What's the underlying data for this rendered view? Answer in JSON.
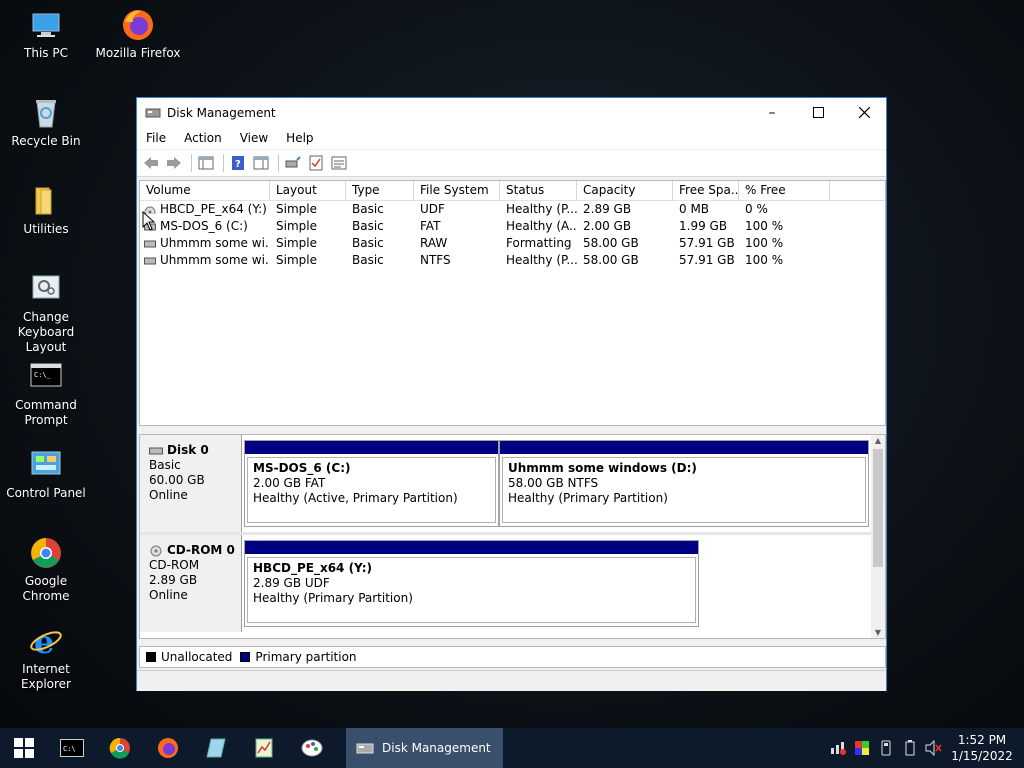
{
  "desktop": {
    "icons": [
      {
        "label": "This PC"
      },
      {
        "label": "Mozilla Firefox"
      },
      {
        "label": "Recycle Bin"
      },
      {
        "label": "Utilities"
      },
      {
        "label": "Change Keyboard Layout"
      },
      {
        "label": "Command Prompt"
      },
      {
        "label": "Control Panel"
      },
      {
        "label": "Google Chrome"
      },
      {
        "label": "Internet Explorer"
      }
    ]
  },
  "window": {
    "title": "Disk Management",
    "menu": [
      "File",
      "Action",
      "View",
      "Help"
    ],
    "columns": [
      "Volume",
      "Layout",
      "Type",
      "File System",
      "Status",
      "Capacity",
      "Free Spa...",
      "% Free"
    ],
    "volumes": [
      [
        "HBCD_PE_x64 (Y:)",
        "Simple",
        "Basic",
        "UDF",
        "Healthy (P...",
        "2.89 GB",
        "0 MB",
        "0 %"
      ],
      [
        "MS-DOS_6 (C:)",
        "Simple",
        "Basic",
        "FAT",
        "Healthy (A...",
        "2.00 GB",
        "1.99 GB",
        "100 %"
      ],
      [
        "Uhmmm some wi...",
        "Simple",
        "Basic",
        "RAW",
        "Formatting",
        "58.00 GB",
        "57.91 GB",
        "100 %"
      ],
      [
        "Uhmmm some wi...",
        "Simple",
        "Basic",
        "NTFS",
        "Healthy (P...",
        "58.00 GB",
        "57.91 GB",
        "100 %"
      ]
    ],
    "disks": [
      {
        "name": "Disk 0",
        "kind": "Basic",
        "size": "60.00 GB",
        "state": "Online",
        "partitions": [
          {
            "name": "MS-DOS_6  (C:)",
            "size": "2.00 GB FAT",
            "status": "Healthy (Active, Primary Partition)"
          },
          {
            "name": "Uhmmm some windows  (D:)",
            "size": "58.00 GB NTFS",
            "status": "Healthy (Primary Partition)"
          }
        ]
      },
      {
        "name": "CD-ROM 0",
        "kind": "CD-ROM",
        "size": "2.89 GB",
        "state": "Online",
        "partitions": [
          {
            "name": "HBCD_PE_x64  (Y:)",
            "size": "2.89 GB UDF",
            "status": "Healthy (Primary Partition)"
          }
        ]
      }
    ],
    "legend": [
      {
        "label": "Unallocated",
        "color": "#000000"
      },
      {
        "label": "Primary partition",
        "color": "#000082"
      }
    ]
  },
  "taskbar": {
    "active_label": "Disk Management",
    "time": "1:52 PM",
    "date": "1/15/2022"
  },
  "colors": {
    "primary_partition": "#000082",
    "window_border": "#3c82c8",
    "taskbar": "#0c1a2c"
  }
}
